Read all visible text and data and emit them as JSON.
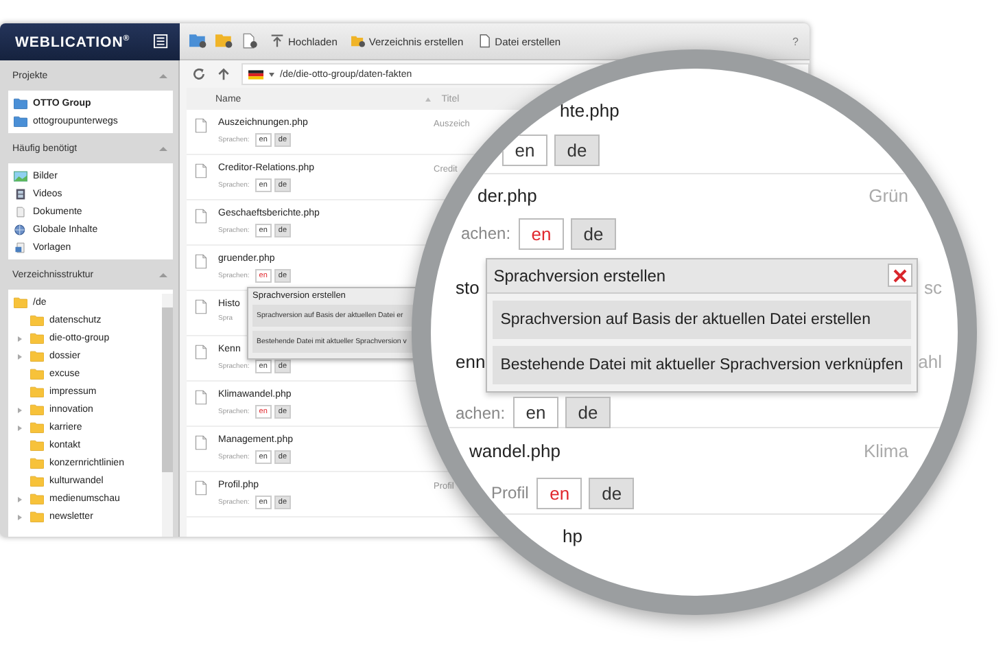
{
  "header": {
    "logo": "WEBLICATION$^{®}$",
    "toolbar": [
      "Hochladen",
      "Verzeichnis erstellen",
      "Datei erstellen"
    ],
    "help": "?"
  },
  "sidebar": {
    "projects": {
      "title": "Projekte",
      "items": [
        {
          "label": "OTTO Group",
          "selected": true
        },
        {
          "label": "ottogroupunterwegs",
          "selected": false
        }
      ]
    },
    "frequent": {
      "title": "Häufig benötigt",
      "items": [
        "Bilder",
        "Videos",
        "Dokumente",
        "Globale Inhalte",
        "Vorlagen"
      ]
    },
    "tree": {
      "title": "Verzeichnisstruktur",
      "root": {
        "label": "/de",
        "children": [
          {
            "label": "datenschutz",
            "expandable": false
          },
          {
            "label": "die-otto-group",
            "expandable": true
          },
          {
            "label": "dossier",
            "expandable": true
          },
          {
            "label": "excuse",
            "expandable": false
          },
          {
            "label": "impressum",
            "expandable": false
          },
          {
            "label": "innovation",
            "expandable": true
          },
          {
            "label": "karriere",
            "expandable": true
          },
          {
            "label": "kontakt",
            "expandable": false
          },
          {
            "label": "konzernrichtlinien",
            "expandable": false
          },
          {
            "label": "kulturwandel",
            "expandable": false
          },
          {
            "label": "medienumschau",
            "expandable": true
          },
          {
            "label": "newsletter",
            "expandable": true
          }
        ]
      }
    }
  },
  "main": {
    "path": "/de/die-otto-group/daten-fakten",
    "columns": [
      "Name",
      "Titel"
    ],
    "rows": [
      {
        "name": "Auszeichnungen.php",
        "title": "Auszeich",
        "lang_label": "Sprachen:",
        "languages": [
          {
            "code": "en",
            "missing": false,
            "selected": false
          },
          {
            "code": "de",
            "missing": false,
            "selected": true
          }
        ]
      },
      {
        "name": "Creditor-Relations.php",
        "title": "Credit",
        "lang_label": "Sprachen:",
        "languages": [
          {
            "code": "en",
            "missing": false,
            "selected": false
          },
          {
            "code": "de",
            "missing": false,
            "selected": true
          }
        ]
      },
      {
        "name": "Geschaeftsberichte.php",
        "lang_label": "Sprachen:",
        "languages": [
          {
            "code": "en",
            "missing": false,
            "selected": false
          },
          {
            "code": "de",
            "missing": false,
            "selected": true
          }
        ]
      },
      {
        "name": "gruender.php",
        "lang_label": "Sprachen:",
        "languages": [
          {
            "code": "en",
            "missing": true,
            "selected": false
          },
          {
            "code": "de",
            "missing": false,
            "selected": true
          }
        ]
      },
      {
        "name": "Histo",
        "lang_label": "Spra"
      },
      {
        "name": "Kenn",
        "lang_label": "Sprachen:",
        "languages": [
          {
            "code": "en",
            "missing": false,
            "selected": false
          },
          {
            "code": "de",
            "missing": false,
            "selected": true
          }
        ]
      },
      {
        "name": "Klimawandel.php",
        "lang_label": "Sprachen:",
        "languages": [
          {
            "code": "en",
            "missing": true,
            "selected": false
          },
          {
            "code": "de",
            "missing": false,
            "selected": true
          }
        ]
      },
      {
        "name": "Management.php",
        "lang_label": "Sprachen:",
        "languages": [
          {
            "code": "en",
            "missing": false,
            "selected": false
          },
          {
            "code": "de",
            "missing": false,
            "selected": true
          }
        ]
      },
      {
        "name": "Profil.php",
        "title": "Profil",
        "lang_label": "Sprachen:",
        "languages": [
          {
            "code": "en",
            "missing": false,
            "selected": false
          },
          {
            "code": "de",
            "missing": false,
            "selected": true
          }
        ]
      }
    ],
    "popup": {
      "title": "Sprachversion erstellen",
      "options": [
        "Sprachversion auf Basis der aktuellen Datei er",
        "Bestehende Datei mit aktueller Sprachversion v"
      ]
    }
  },
  "magnifier": {
    "rows": [
      {
        "kind": "name",
        "name": "hte.php"
      },
      {
        "kind": "languages",
        "languages": [
          {
            "code": "en",
            "missing": false,
            "selected": false
          },
          {
            "code": "de",
            "missing": false,
            "selected": true
          }
        ]
      },
      {
        "kind": "name",
        "name": "der.php",
        "title": "Grün"
      },
      {
        "kind": "languages",
        "label": "achen:",
        "languages": [
          {
            "code": "en",
            "missing": true,
            "selected": false
          },
          {
            "code": "de",
            "missing": false,
            "selected": true
          }
        ]
      },
      {
        "kind": "dialog",
        "title": "Sprachversion erstellen",
        "options": [
          "Sprachversion auf Basis der aktuellen Datei erstellen",
          "Bestehende Datei mit aktueller Sprachversion verknüpfen"
        ],
        "left_texts": [
          "sto",
          "enn"
        ],
        "right_texts": [
          "sc",
          "ahl"
        ]
      },
      {
        "kind": "languages",
        "label": "achen:",
        "languages": [
          {
            "code": "en",
            "missing": false,
            "selected": false
          },
          {
            "code": "de",
            "missing": false,
            "selected": true
          }
        ]
      },
      {
        "kind": "name",
        "name": "wandel.php",
        "title": "Klima"
      },
      {
        "kind": "languages",
        "label": "Profil",
        "languages": [
          {
            "code": "en",
            "missing": true,
            "selected": false
          },
          {
            "code": "de",
            "missing": false,
            "selected": true
          }
        ]
      },
      {
        "kind": "name",
        "name": "hp"
      }
    ]
  }
}
